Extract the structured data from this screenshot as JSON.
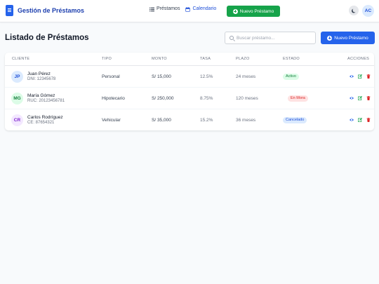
{
  "header": {
    "title": "Gestión de Préstamos",
    "nav": [
      {
        "label": "Préstamos",
        "icon": "list-icon",
        "active": false
      },
      {
        "label": "Calendario",
        "icon": "calendar-icon",
        "active": true
      }
    ],
    "new_loan_button": "Nuevo Préstamo",
    "user_initials": "AC"
  },
  "page": {
    "title": "Listado de Préstamos",
    "search_placeholder": "Buscar préstamo...",
    "new_loan_button": "Nuevo Préstamo"
  },
  "table": {
    "columns": [
      "CLIENTE",
      "TIPO",
      "MONTO",
      "TASA",
      "PLAZO",
      "ESTADO",
      "ACCIONES"
    ],
    "rows": [
      {
        "initials": "JP",
        "name": "Juan Pérez",
        "doc": "DNI: 12345678",
        "type": "Personal",
        "amount": "S/ 15,000",
        "rate": "12.5%",
        "term": "24 meses",
        "status": "Activo",
        "status_color": "#15803d"
      },
      {
        "initials": "MG",
        "name": "María Gómez",
        "doc": "RUC: 20123456781",
        "type": "Hipotecario",
        "amount": "S/ 250,000",
        "rate": "8.75%",
        "term": "120 meses",
        "status": "En Mora",
        "status_color": "#dc2626"
      },
      {
        "initials": "CR",
        "name": "Carlos Rodríguez",
        "doc": "CE: 87654321",
        "type": "Vehicular",
        "amount": "S/ 35,000",
        "rate": "15.2%",
        "term": "36 meses",
        "status": "Cancelado",
        "status_color": "#1d4ed8"
      }
    ]
  },
  "colors": {
    "primary": "#2563eb",
    "success": "#16a34a",
    "danger": "#dc2626"
  }
}
